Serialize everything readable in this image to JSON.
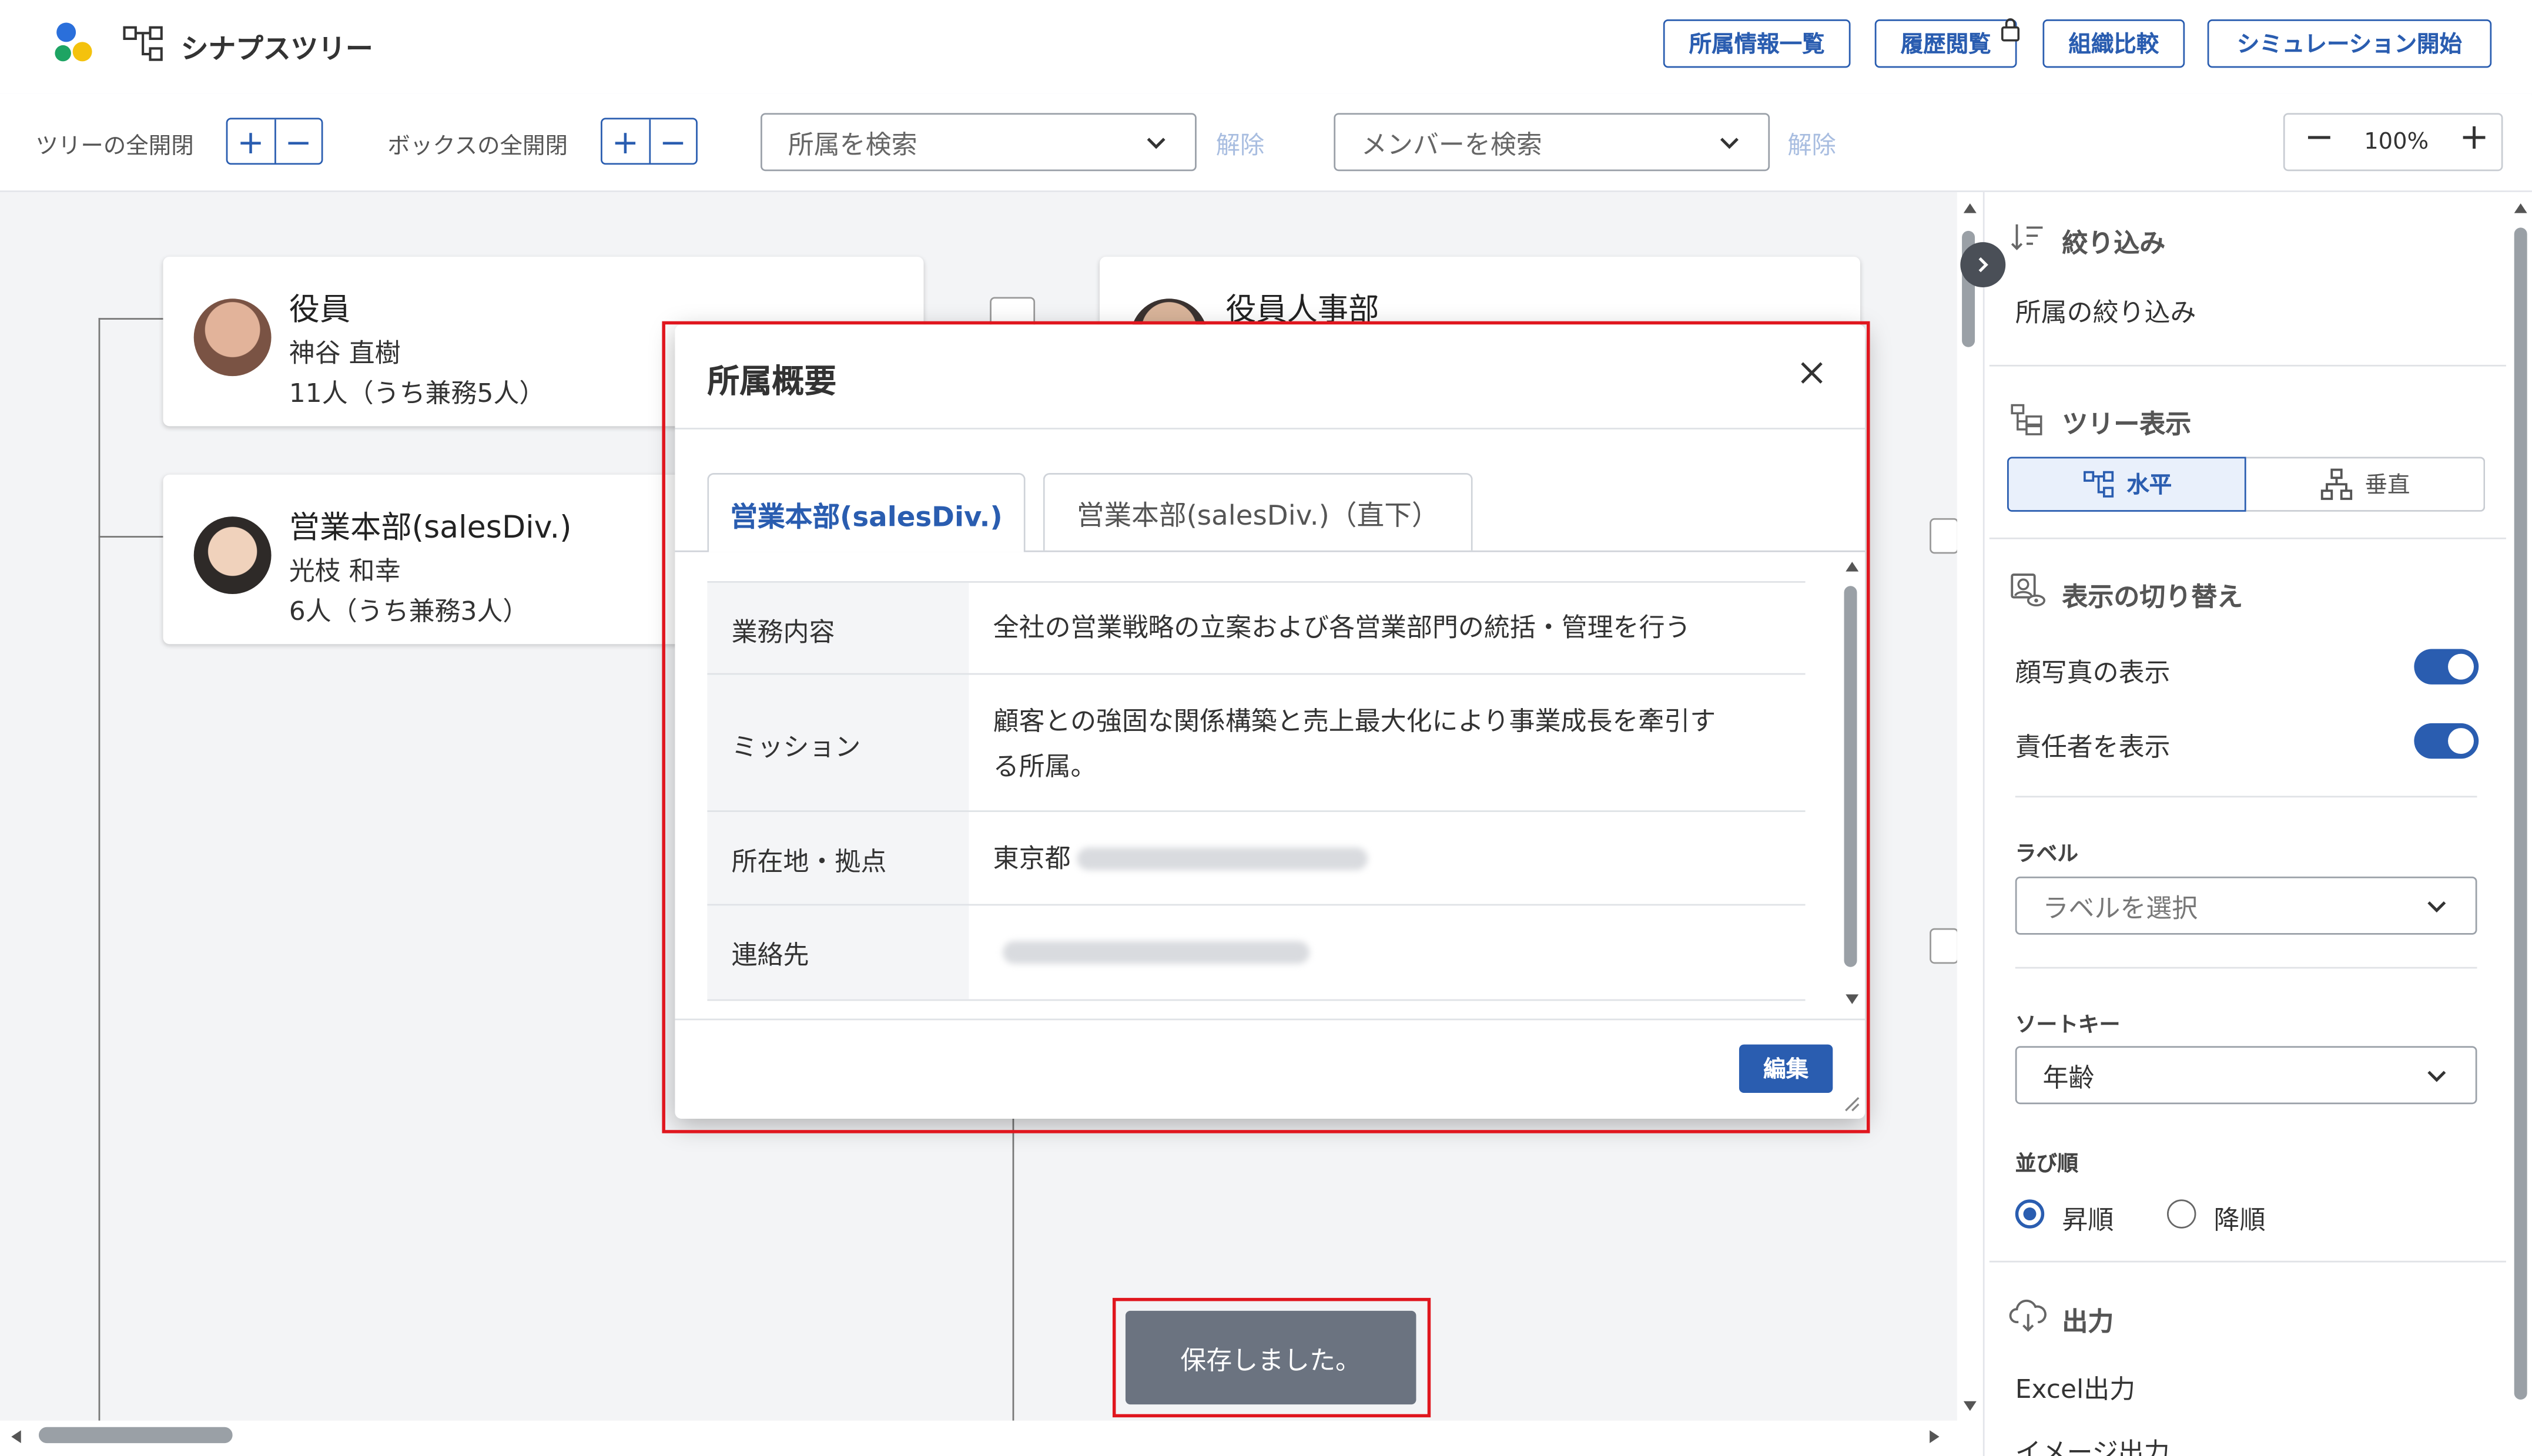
{
  "app": {
    "title": "シナプスツリー"
  },
  "header_buttons": [
    "所属情報一覧",
    "履歴閲覧",
    "組織比較",
    "シミュレーション開始"
  ],
  "toolbar": {
    "tree_expand_label": "ツリーの全開閉",
    "box_expand_label": "ボックスの全開閉",
    "dept_search_placeholder": "所属を検索",
    "member_search_placeholder": "メンバーを検索",
    "clear_label": "解除",
    "zoom": "100%"
  },
  "cards": [
    {
      "title": "役員",
      "manager": "神谷 直樹",
      "count": "11人（うち兼務5人）"
    },
    {
      "title": "営業本部(salesDiv.)",
      "manager": "光枝 和幸",
      "count": "6人（うち兼務3人）"
    },
    {
      "title": "役員人事部"
    }
  ],
  "panel": {
    "filter_title": "絞り込み",
    "filter_item": "所属の絞り込み",
    "tree_view_title": "ツリー表示",
    "horizontal": "水平",
    "vertical": "垂直",
    "display_toggle_title": "表示の切り替え",
    "show_photo": "顔写真の表示",
    "show_manager": "責任者を表示",
    "label_title": "ラベル",
    "label_placeholder": "ラベルを選択",
    "sort_key_title": "ソートキー",
    "sort_key_value": "年齢",
    "order_title": "並び順",
    "asc": "昇順",
    "desc": "降順",
    "output_title": "出力",
    "excel_output": "Excel出力",
    "image_output": "イメージ出力"
  },
  "modal": {
    "title": "所属概要",
    "tabs": [
      "営業本部(salesDiv.)",
      "営業本部(salesDiv.)（直下）"
    ],
    "rows": [
      {
        "label": "業務内容",
        "value": "全社の営業戦略の立案および各営業部門の統括・管理を行う"
      },
      {
        "label": "ミッション",
        "value_line1": "顧客との強固な関係構築と売上最大化により事業成長を牽引す",
        "value_line2": "る所属。"
      },
      {
        "label": "所在地・拠点",
        "value": "東京都"
      },
      {
        "label": "連絡先",
        "value": ""
      }
    ],
    "edit_button": "編集"
  },
  "toast": "保存しました。",
  "colors": {
    "accent": "#2a5db0",
    "highlight": "#e0161e",
    "toast_bg": "#6b7380"
  }
}
